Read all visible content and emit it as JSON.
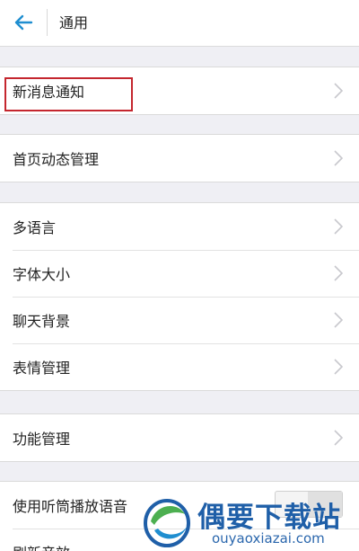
{
  "header": {
    "back_icon": "arrow-left-icon",
    "title": "通用"
  },
  "groups": [
    {
      "rows": [
        "新消息通知"
      ]
    },
    {
      "rows": [
        "首页动态管理"
      ]
    },
    {
      "rows": [
        "多语言",
        "字体大小",
        "聊天背景",
        "表情管理"
      ]
    },
    {
      "rows": [
        "功能管理"
      ]
    },
    {
      "rows": [
        "使用听筒播放语音",
        "刷新音效"
      ]
    }
  ],
  "colors": {
    "accent": "#1f8ed0",
    "highlight_box": "#c4262e",
    "background": "#efeff4"
  },
  "watermark": {
    "brand": "偶要下载站",
    "url": "ouyaoxiazai.com"
  }
}
